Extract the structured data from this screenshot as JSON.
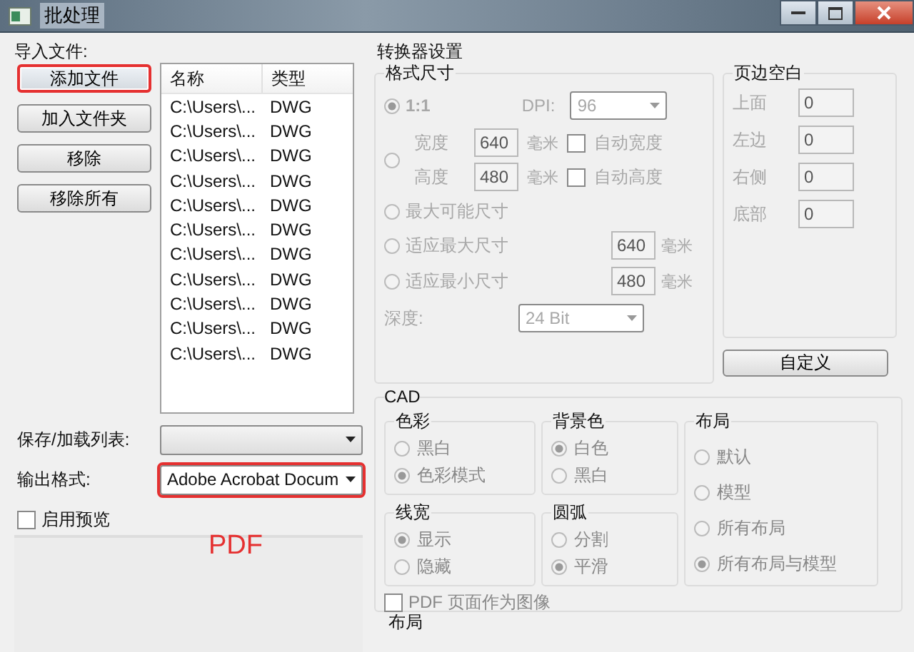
{
  "window": {
    "title": "批处理"
  },
  "import": {
    "label": "导入文件:",
    "buttons": [
      {
        "label": "添加文件",
        "highlighted": true
      },
      {
        "label": "加入文件夹",
        "highlighted": false
      },
      {
        "label": "移除",
        "highlighted": false
      },
      {
        "label": "移除所有",
        "highlighted": false
      }
    ],
    "file_list": {
      "columns": [
        "名称",
        "类型"
      ],
      "rows": [
        [
          "C:\\Users\\...",
          "DWG"
        ],
        [
          "C:\\Users\\...",
          "DWG"
        ],
        [
          "C:\\Users\\...",
          "DWG"
        ],
        [
          "C:\\Users\\...",
          "DWG"
        ],
        [
          "C:\\Users\\...",
          "DWG"
        ],
        [
          "C:\\Users\\...",
          "DWG"
        ],
        [
          "C:\\Users\\...",
          "DWG"
        ],
        [
          "C:\\Users\\...",
          "DWG"
        ],
        [
          "C:\\Users\\...",
          "DWG"
        ],
        [
          "C:\\Users\\...",
          "DWG"
        ],
        [
          "C:\\Users\\...",
          "DWG"
        ]
      ]
    }
  },
  "save_list": {
    "label": "保存/加载列表:"
  },
  "output_format": {
    "label": "输出格式:",
    "value": "Adobe Acrobat Docum",
    "highlighted": true
  },
  "preview": {
    "label": "启用预览",
    "checked": false
  },
  "annotation": "PDF",
  "converter": {
    "title": "转换器设置",
    "format_size": {
      "title": "格式尺寸",
      "disabled": true,
      "ratio": {
        "label": "1:1",
        "selected": true
      },
      "dpi": {
        "label": "DPI:",
        "value": "96"
      },
      "custom": {
        "selected": false,
        "fields": [
          {
            "label": "宽度",
            "value": "640",
            "unit": "毫米",
            "auto_label": "自动宽度",
            "auto_checked": false
          },
          {
            "label": "高度",
            "value": "480",
            "unit": "毫米",
            "auto_label": "自动高度",
            "auto_checked": false
          }
        ]
      },
      "max_possible": {
        "label": "最大可能尺寸",
        "selected": false
      },
      "fits": [
        {
          "label": "适应最大尺寸",
          "selected": false,
          "value": "640",
          "unit": "毫米"
        },
        {
          "label": "适应最小尺寸",
          "selected": false,
          "value": "480",
          "unit": "毫米"
        }
      ],
      "depth": {
        "label": "深度:",
        "value": "24 Bit"
      }
    },
    "margins": {
      "title": "页边空白",
      "fields": [
        {
          "label": "上面",
          "value": "0"
        },
        {
          "label": "左边",
          "value": "0"
        },
        {
          "label": "右侧",
          "value": "0"
        },
        {
          "label": "底部",
          "value": "0"
        }
      ]
    },
    "custom_button": "自定义",
    "cad": {
      "title": "CAD",
      "groups": [
        {
          "title": "色彩",
          "options": [
            {
              "label": "黑白",
              "selected": false
            },
            {
              "label": "色彩模式",
              "selected": true
            }
          ]
        },
        {
          "title": "线宽",
          "options": [
            {
              "label": "显示",
              "selected": true
            },
            {
              "label": "隐藏",
              "selected": false
            }
          ]
        },
        {
          "title": "背景色",
          "options": [
            {
              "label": "白色",
              "selected": true
            },
            {
              "label": "黑白",
              "selected": false
            }
          ]
        },
        {
          "title": "圆弧",
          "options": [
            {
              "label": "分割",
              "selected": false
            },
            {
              "label": "平滑",
              "selected": true
            }
          ]
        },
        {
          "title": "布局",
          "options": [
            {
              "label": "默认",
              "selected": false
            },
            {
              "label": "模型",
              "selected": false
            },
            {
              "label": "所有布局",
              "selected": false
            },
            {
              "label": "所有布局与模型",
              "selected": true
            }
          ]
        }
      ],
      "pdf_as_image": {
        "label": "PDF 页面作为图像",
        "checked": false
      }
    },
    "layout_heading": "布局"
  }
}
